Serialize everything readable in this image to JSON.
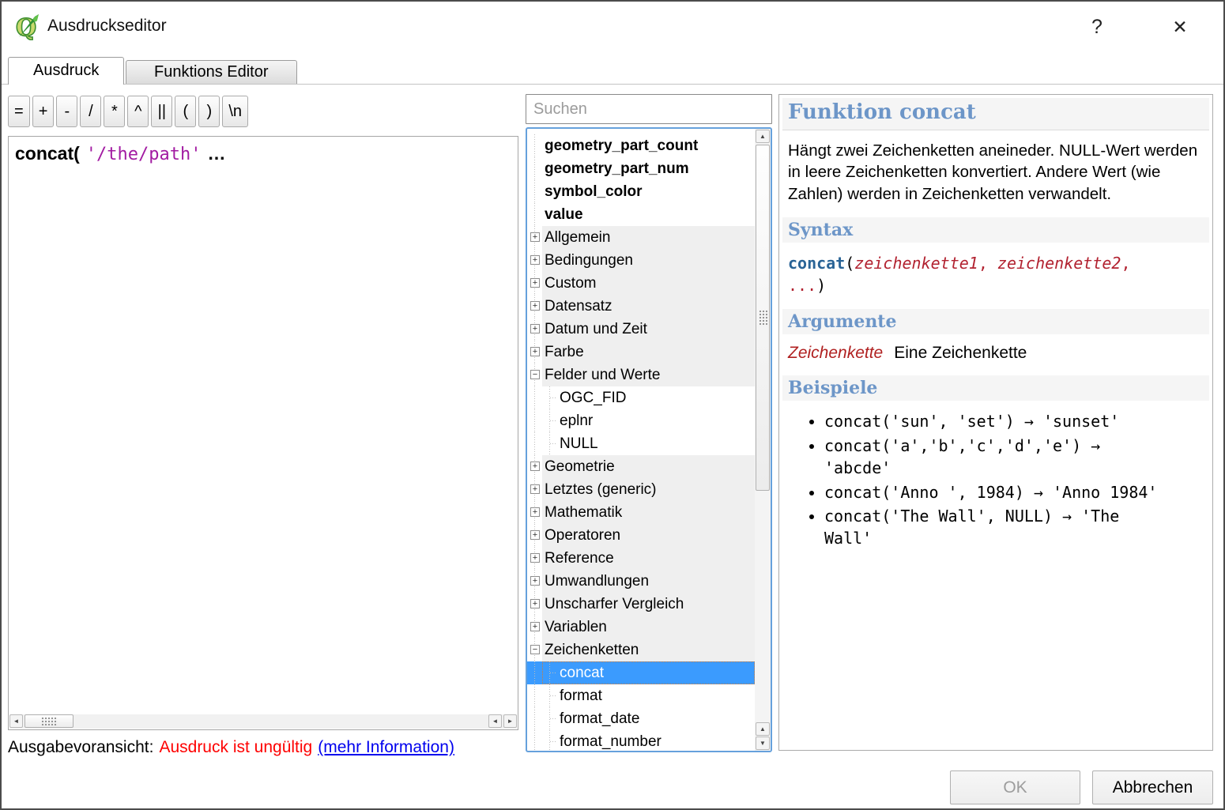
{
  "window": {
    "title": "Ausdruckseditor",
    "help_glyph": "?",
    "close_glyph": "✕"
  },
  "tabs": {
    "expression": "Ausdruck",
    "function_editor": "Funktions Editor"
  },
  "operators": [
    {
      "label": "="
    },
    {
      "label": "+"
    },
    {
      "label": "-"
    },
    {
      "label": "/"
    },
    {
      "label": "*"
    },
    {
      "label": "^"
    },
    {
      "label": "||"
    },
    {
      "label": "("
    },
    {
      "label": ")"
    },
    {
      "label": "\\n"
    }
  ],
  "expression_editor": {
    "function_token": "concat(",
    "string_token": "'/the/path'",
    "ellipsis_token": "…"
  },
  "function_search": {
    "placeholder": "Suchen"
  },
  "function_tree": {
    "items": [
      {
        "label": "geometry_part_count",
        "kind": "field",
        "exp": ""
      },
      {
        "label": "geometry_part_num",
        "kind": "field",
        "exp": ""
      },
      {
        "label": "symbol_color",
        "kind": "field",
        "exp": ""
      },
      {
        "label": "value",
        "kind": "field",
        "exp": ""
      },
      {
        "label": "Allgemein",
        "kind": "group",
        "exp": "+"
      },
      {
        "label": "Bedingungen",
        "kind": "group",
        "exp": "+"
      },
      {
        "label": "Custom",
        "kind": "group",
        "exp": "+"
      },
      {
        "label": "Datensatz",
        "kind": "group",
        "exp": "+"
      },
      {
        "label": "Datum und Zeit",
        "kind": "group",
        "exp": "+"
      },
      {
        "label": "Farbe",
        "kind": "group",
        "exp": "+"
      },
      {
        "label": "Felder und Werte",
        "kind": "group",
        "exp": "−"
      },
      {
        "label": "OGC_FID",
        "kind": "child",
        "exp": ""
      },
      {
        "label": "eplnr",
        "kind": "child",
        "exp": ""
      },
      {
        "label": "NULL",
        "kind": "child",
        "exp": ""
      },
      {
        "label": "Geometrie",
        "kind": "group",
        "exp": "+"
      },
      {
        "label": "Letztes (generic)",
        "kind": "group",
        "exp": "+"
      },
      {
        "label": "Mathematik",
        "kind": "group",
        "exp": "+"
      },
      {
        "label": "Operatoren",
        "kind": "group",
        "exp": "+"
      },
      {
        "label": "Reference",
        "kind": "group",
        "exp": "+"
      },
      {
        "label": "Umwandlungen",
        "kind": "group",
        "exp": "+"
      },
      {
        "label": "Unscharfer Vergleich",
        "kind": "group",
        "exp": "+"
      },
      {
        "label": "Variablen",
        "kind": "group",
        "exp": "+"
      },
      {
        "label": "Zeichenketten",
        "kind": "group",
        "exp": "−"
      },
      {
        "label": "concat",
        "kind": "child selected",
        "exp": ""
      },
      {
        "label": "format",
        "kind": "child",
        "exp": ""
      },
      {
        "label": "format_date",
        "kind": "child",
        "exp": ""
      },
      {
        "label": "format_number",
        "kind": "child",
        "exp": ""
      }
    ]
  },
  "help_panel": {
    "title": "Funktion concat",
    "description": "Hängt zwei Zeichenketten aneineder. NULL-Wert werden in leere Zeichenketten konvertiert. Andere Wert (wie Zahlen) werden in Zeichenketten verwandelt.",
    "syntax_heading": "Syntax",
    "syntax_tokens": [
      {
        "t": "concat",
        "c": "fn"
      },
      {
        "t": "(",
        "c": "pl"
      },
      {
        "t": "zeichenkette1",
        "c": "arg"
      },
      {
        "t": ", ",
        "c": "argc"
      },
      {
        "t": "zeichenkette2",
        "c": "arg"
      },
      {
        "t": ",\n",
        "c": "argc"
      },
      {
        "t": "...",
        "c": "argc"
      },
      {
        "t": ")",
        "c": "pl"
      }
    ],
    "arguments_heading": "Argumente",
    "argument_name": "Zeichenkette",
    "argument_desc": "Eine Zeichenkette",
    "examples_heading": "Beispiele",
    "examples": [
      {
        "code": "concat('sun', 'set') → 'sunset'"
      },
      {
        "code": "concat('a','b','c','d','e') → 'abcde'"
      },
      {
        "code": "concat('Anno ', 1984) → 'Anno 1984'"
      },
      {
        "code": "concat('The Wall', NULL) → 'The Wall'"
      }
    ]
  },
  "output_preview": {
    "label": "Ausgabevoransicht:",
    "error_text": "Ausdruck ist ungültig",
    "link_text": "(mehr Information)"
  },
  "dialog_buttons": {
    "ok": "OK",
    "cancel": "Abbrechen"
  },
  "colors": {
    "selection": "#3b9bfe",
    "help_heading": "#6d96c8",
    "error": "#fe0000",
    "link": "#0000ee",
    "expression_string": "#a21ba2"
  }
}
